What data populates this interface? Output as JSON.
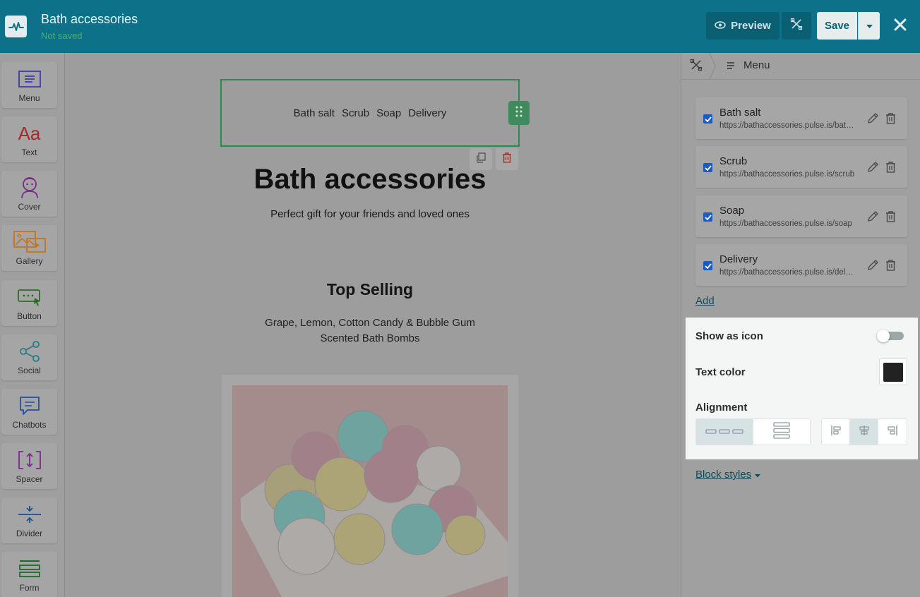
{
  "header": {
    "title": "Bath accessories",
    "status": "Not saved",
    "preview_label": "Preview",
    "save_label": "Save"
  },
  "toolbar": {
    "items": [
      {
        "label": "Menu",
        "icon": "menu-icon",
        "color": "#3d3aa8"
      },
      {
        "label": "Text",
        "icon": "text-icon",
        "color": "#a52929"
      },
      {
        "label": "Cover",
        "icon": "cover-icon",
        "color": "#7b2a8f"
      },
      {
        "label": "Gallery",
        "icon": "gallery-icon",
        "color": "#c7731a"
      },
      {
        "label": "Button",
        "icon": "button-icon",
        "color": "#2f6b2a"
      },
      {
        "label": "Social",
        "icon": "social-icon",
        "color": "#2a7a87"
      },
      {
        "label": "Chatbots",
        "icon": "chatbots-icon",
        "color": "#244f9c"
      },
      {
        "label": "Spacer",
        "icon": "spacer-icon",
        "color": "#7b2a8f"
      },
      {
        "label": "Divider",
        "icon": "divider-icon",
        "color": "#1f4e86"
      },
      {
        "label": "Form",
        "icon": "form-icon",
        "color": "#1d6b2b"
      }
    ]
  },
  "canvas": {
    "menu_items": [
      "Bath salt",
      "Scrub",
      "Soap",
      "Delivery"
    ],
    "heading": "Bath accessories",
    "tagline": "Perfect gift for your friends and loved ones",
    "section_title": "Top Selling",
    "section_desc_line1": "Grape, Lemon, Cotton Candy & Bubble Gum",
    "section_desc_line2": "Scented Bath Bombs"
  },
  "panel": {
    "breadcrumb_label": "Menu",
    "items": [
      {
        "name": "Bath salt",
        "url": "https://bathaccessories.pulse.is/bath-salt",
        "checked": true
      },
      {
        "name": "Scrub",
        "url": "https://bathaccessories.pulse.is/scrub",
        "checked": true
      },
      {
        "name": "Soap",
        "url": "https://bathaccessories.pulse.is/soap",
        "checked": true
      },
      {
        "name": "Delivery",
        "url": "https://bathaccessories.pulse.is/delivery",
        "checked": true
      }
    ],
    "add_label": "Add",
    "show_as_icon_label": "Show as icon",
    "show_as_icon": false,
    "text_color_label": "Text color",
    "text_color": "#222222",
    "alignment_label": "Alignment",
    "block_styles_label": "Block styles"
  },
  "colors": {
    "topbar": "#0d7289",
    "accent_green": "#2a8a4f",
    "link": "#0f4d5c"
  }
}
